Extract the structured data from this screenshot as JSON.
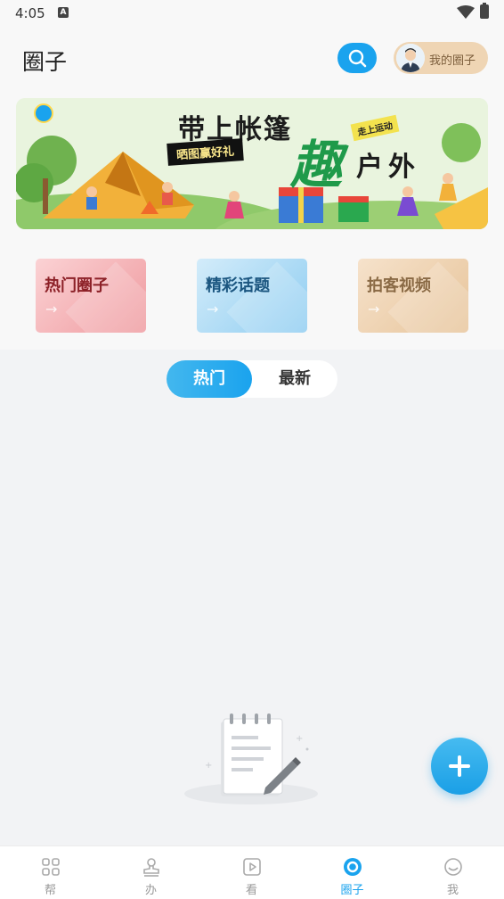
{
  "status_bar": {
    "time": "4:05",
    "notif_icon_letter": "A"
  },
  "header": {
    "title": "圈子",
    "my_circle_label": "我的圈子"
  },
  "banner": {
    "title": "带上帐篷",
    "tag_left": "晒图赢好礼",
    "tag_right": "走上运动",
    "big_char": "趣",
    "subtitle": "户外"
  },
  "categories": [
    {
      "label": "热门圈子",
      "arrow": "→"
    },
    {
      "label": "精彩话题",
      "arrow": "→"
    },
    {
      "label": "拍客视频",
      "arrow": "→"
    }
  ],
  "tabs": {
    "hot": "热门",
    "latest": "最新",
    "active": "hot"
  },
  "bottom_nav": [
    {
      "label": "帮",
      "icon": "grid-icon"
    },
    {
      "label": "办",
      "icon": "stamp-icon"
    },
    {
      "label": "看",
      "icon": "play-icon"
    },
    {
      "label": "圈子",
      "icon": "circle-icon",
      "active": true
    },
    {
      "label": "我",
      "icon": "smile-icon"
    }
  ],
  "colors": {
    "accent": "#1aa3ee",
    "my_circle_bg": "#efd5b4",
    "hot_card": "#ef9a9f",
    "topic_card": "#8fcdf1",
    "video_card": "#e7c49a"
  }
}
